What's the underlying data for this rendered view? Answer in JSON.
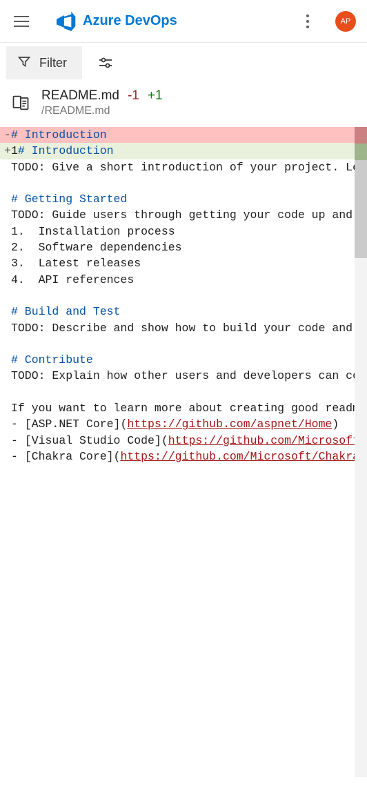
{
  "header": {
    "brand": "Azure DevOps",
    "avatar": "AP"
  },
  "toolbar": {
    "filter_label": "Filter"
  },
  "file": {
    "name": "README.md",
    "removed": "-1",
    "added": "+1",
    "path": "/README.md"
  },
  "diff": {
    "lines": [
      {
        "type": "removed",
        "marker": "-",
        "num": "",
        "segments": [
          {
            "cls": "md-heading",
            "text": "# Introduction"
          }
        ]
      },
      {
        "type": "added",
        "marker": "+",
        "num": "1",
        "segments": [
          {
            "cls": "md-heading",
            "text": "# Introduction"
          }
        ]
      },
      {
        "type": "context",
        "marker": "",
        "num": "",
        "segments": [
          {
            "cls": "md-text",
            "text": "TODO: Give a short introduction of your project. Let this section explain the object"
          }
        ]
      },
      {
        "type": "context",
        "marker": "",
        "num": "",
        "segments": [
          {
            "cls": "md-text",
            "text": ""
          }
        ]
      },
      {
        "type": "context",
        "marker": "",
        "num": "",
        "segments": [
          {
            "cls": "md-heading",
            "text": "# Getting Started"
          }
        ]
      },
      {
        "type": "context",
        "marker": "",
        "num": "",
        "segments": [
          {
            "cls": "md-text",
            "text": "TODO: Guide users through getting your code up and running on their own syste"
          }
        ]
      },
      {
        "type": "context",
        "marker": "",
        "num": "",
        "segments": [
          {
            "cls": "md-text",
            "text": "1.  Installation process"
          }
        ]
      },
      {
        "type": "context",
        "marker": "",
        "num": "",
        "segments": [
          {
            "cls": "md-text",
            "text": "2.  Software dependencies"
          }
        ]
      },
      {
        "type": "context",
        "marker": "",
        "num": "",
        "segments": [
          {
            "cls": "md-text",
            "text": "3.  Latest releases"
          }
        ]
      },
      {
        "type": "context",
        "marker": "",
        "num": "",
        "segments": [
          {
            "cls": "md-text",
            "text": "4.  API references"
          }
        ]
      },
      {
        "type": "context",
        "marker": "",
        "num": "",
        "segments": [
          {
            "cls": "md-text",
            "text": ""
          }
        ]
      },
      {
        "type": "context",
        "marker": "",
        "num": "",
        "segments": [
          {
            "cls": "md-heading",
            "text": "# Build and Test"
          }
        ]
      },
      {
        "type": "context",
        "marker": "",
        "num": "",
        "segments": [
          {
            "cls": "md-text",
            "text": "TODO: Describe and show how to build your code and run the tests."
          }
        ]
      },
      {
        "type": "context",
        "marker": "",
        "num": "",
        "segments": [
          {
            "cls": "md-text",
            "text": ""
          }
        ]
      },
      {
        "type": "context",
        "marker": "",
        "num": "",
        "segments": [
          {
            "cls": "md-heading",
            "text": "# Contribute"
          }
        ]
      },
      {
        "type": "context",
        "marker": "",
        "num": "",
        "segments": [
          {
            "cls": "md-text",
            "text": "TODO: Explain how other users and developers can contribute to make your code"
          }
        ]
      },
      {
        "type": "context",
        "marker": "",
        "num": "",
        "segments": [
          {
            "cls": "md-text",
            "text": ""
          }
        ]
      },
      {
        "type": "context",
        "marker": "",
        "num": "",
        "segments": [
          {
            "cls": "md-text",
            "text": "If you want to learn more about creating good readme files then refer the fol"
          }
        ]
      },
      {
        "type": "context",
        "marker": "",
        "num": "",
        "segments": [
          {
            "cls": "md-text",
            "text": "- "
          },
          {
            "cls": "md-link-text",
            "text": "[ASP.NET Core]"
          },
          {
            "cls": "md-text",
            "text": "("
          },
          {
            "cls": "md-link-url",
            "text": "https://github.com/aspnet/Home"
          },
          {
            "cls": "md-text",
            "text": ")"
          }
        ]
      },
      {
        "type": "context",
        "marker": "",
        "num": "",
        "segments": [
          {
            "cls": "md-text",
            "text": "- "
          },
          {
            "cls": "md-link-text",
            "text": "[Visual Studio Code]"
          },
          {
            "cls": "md-text",
            "text": "("
          },
          {
            "cls": "md-link-url",
            "text": "https://github.com/Microsoft/vscode"
          }
        ]
      },
      {
        "type": "context",
        "marker": "",
        "num": "",
        "segments": [
          {
            "cls": "md-text",
            "text": "- "
          },
          {
            "cls": "md-link-text",
            "text": "[Chakra Core]"
          },
          {
            "cls": "md-text",
            "text": "("
          },
          {
            "cls": "md-link-url",
            "text": "https://github.com/Microsoft/ChakraCore"
          }
        ]
      }
    ]
  }
}
